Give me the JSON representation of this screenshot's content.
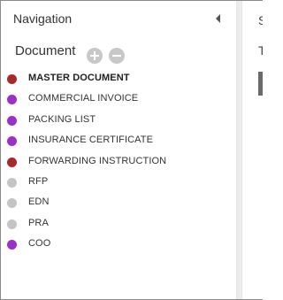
{
  "nav": {
    "title": "Navigation",
    "collapse_icon": "chevron-left-icon"
  },
  "documents": {
    "header": "Document",
    "add_icon": "plus-circle-icon",
    "remove_icon": "minus-circle-icon",
    "items": [
      {
        "label": "MASTER DOCUMENT",
        "color": "#a52a2a",
        "active": true
      },
      {
        "label": "COMMERCIAL INVOICE",
        "color": "#9b30c8",
        "active": false
      },
      {
        "label": "PACKING LIST",
        "color": "#9b30c8",
        "active": false
      },
      {
        "label": "INSURANCE CERTIFICATE",
        "color": "#9b30c8",
        "active": false
      },
      {
        "label": "FORWARDING INSTRUCTION",
        "color": "#a52a2a",
        "active": false
      },
      {
        "label": "RFP",
        "color": "#c4c4c4",
        "active": false
      },
      {
        "label": "EDN",
        "color": "#c4c4c4",
        "active": false
      },
      {
        "label": "PRA",
        "color": "#c4c4c4",
        "active": false
      },
      {
        "label": "COO",
        "color": "#9b30c8",
        "active": false
      }
    ]
  },
  "right_panel": {
    "heading_fragment": "S",
    "subheading_fragment": "T"
  }
}
